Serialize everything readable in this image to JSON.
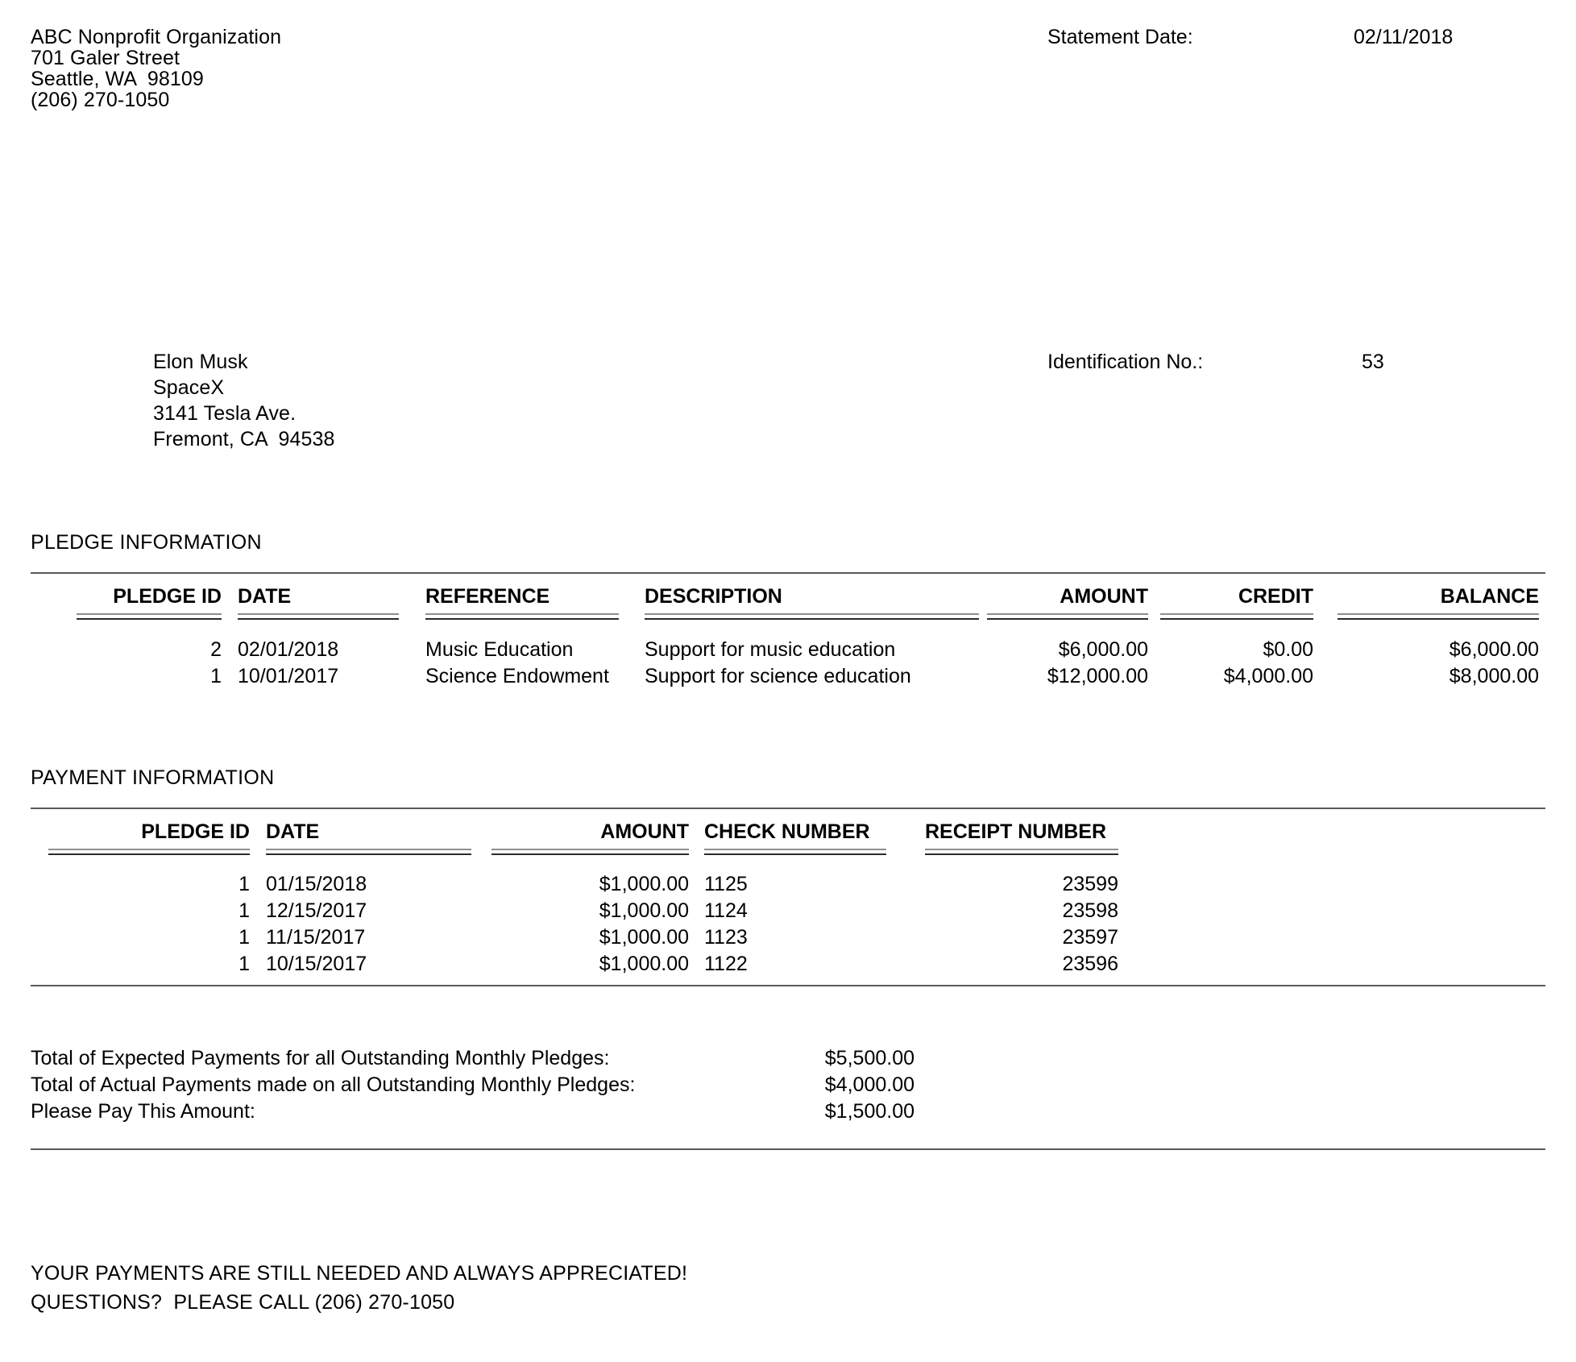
{
  "organization": {
    "name": "ABC Nonprofit Organization",
    "street": "701 Galer Street",
    "city_state_zip": "Seattle, WA  98109",
    "phone": "(206) 270-1050"
  },
  "statement": {
    "date_label": "Statement Date:",
    "date_value": "02/11/2018",
    "id_label": "Identification No.:",
    "id_value": "53"
  },
  "recipient": {
    "name": "Elon Musk",
    "company": "SpaceX",
    "street": "3141 Tesla Ave.",
    "city_state_zip": "Fremont, CA  94538"
  },
  "pledge_section": {
    "title": "PLEDGE INFORMATION",
    "headers": {
      "pledge_id": "PLEDGE ID",
      "date": "DATE",
      "reference": "REFERENCE",
      "description": "DESCRIPTION",
      "amount": "AMOUNT",
      "credit": "CREDIT",
      "balance": "BALANCE"
    },
    "rows": [
      {
        "pledge_id": "2",
        "date": "02/01/2018",
        "reference": "Music Education",
        "description": "Support for music education",
        "amount": "$6,000.00",
        "credit": "$0.00",
        "balance": "$6,000.00"
      },
      {
        "pledge_id": "1",
        "date": "10/01/2017",
        "reference": "Science Endowment",
        "description": "Support for science education",
        "amount": "$12,000.00",
        "credit": "$4,000.00",
        "balance": "$8,000.00"
      }
    ]
  },
  "payment_section": {
    "title": "PAYMENT INFORMATION",
    "headers": {
      "pledge_id": "PLEDGE ID",
      "date": "DATE",
      "amount": "AMOUNT",
      "check_number": "CHECK NUMBER",
      "receipt_number": "RECEIPT NUMBER"
    },
    "rows": [
      {
        "pledge_id": "1",
        "date": "01/15/2018",
        "amount": "$1,000.00",
        "check_number": "1125",
        "receipt_number": "23599"
      },
      {
        "pledge_id": "1",
        "date": "12/15/2017",
        "amount": "$1,000.00",
        "check_number": "1124",
        "receipt_number": "23598"
      },
      {
        "pledge_id": "1",
        "date": "11/15/2017",
        "amount": "$1,000.00",
        "check_number": "1123",
        "receipt_number": "23597"
      },
      {
        "pledge_id": "1",
        "date": "10/15/2017",
        "amount": "$1,000.00",
        "check_number": "1122",
        "receipt_number": "23596"
      }
    ]
  },
  "totals": [
    {
      "label": "Total of Expected Payments for all Outstanding Monthly Pledges:",
      "value": "$5,500.00"
    },
    {
      "label": "Total of Actual Payments made on all Outstanding Monthly Pledges:",
      "value": "$4,000.00"
    },
    {
      "label": "Please Pay This Amount:",
      "value": "$1,500.00"
    }
  ],
  "footer": {
    "line1": "YOUR PAYMENTS ARE STILL NEEDED AND ALWAYS APPRECIATED!",
    "line2": "QUESTIONS?  PLEASE CALL (206) 270-1050"
  }
}
